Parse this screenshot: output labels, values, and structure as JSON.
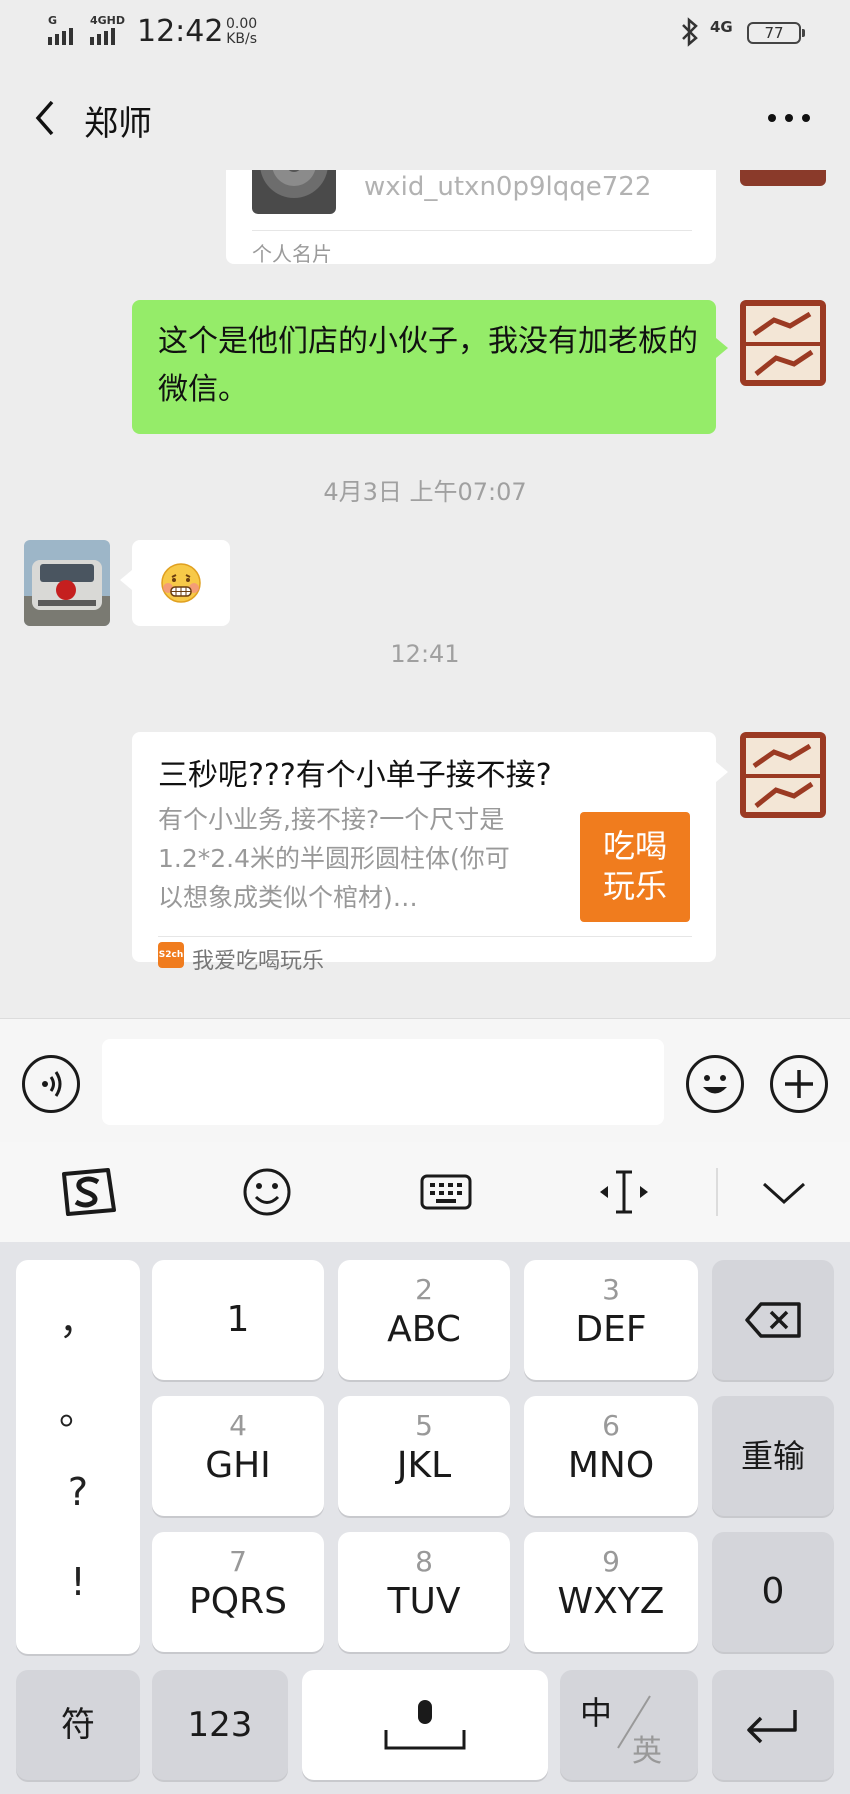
{
  "status_bar": {
    "signal1": "G",
    "signal2": "4GHD",
    "time": "12:42",
    "speed_value": "0.00",
    "speed_unit": "KB/s",
    "network": "4G",
    "battery": "77"
  },
  "header": {
    "title": "郑师",
    "back_icon": "chevron-left-icon",
    "more_icon": "more-dots-icon"
  },
  "messages": {
    "card": {
      "wxid": "wxid_utxn0p9lqqe722",
      "footer": "个人名片"
    },
    "sent_text": "这个是他们店的小伙子，我没有加老板的微信。",
    "timestamp1": "4月3日 上午07:07",
    "received_emoji": "grimacing-face-emoji",
    "timestamp2": "12:41",
    "link_card": {
      "title": "三秒呢???有个小单子接不接?",
      "description": "有个小业务,接不接?一个尺寸是1.2*2.4米的半圆形圆柱体(你可以想象成类似个棺材)…",
      "thumb_text_line1": "吃喝",
      "thumb_text_line2": "玩乐",
      "source_icon_text": "S2ch",
      "source": "我爱吃喝玩乐"
    }
  },
  "input_bar": {
    "voice_icon": "voice-icon",
    "emoji_icon": "smiley-icon",
    "plus_icon": "plus-icon"
  },
  "keyboard_toolbar": {
    "icons": [
      "sogou-logo-icon",
      "smiley-icon",
      "keyboard-icon",
      "cursor-move-icon",
      "chevron-down-icon"
    ]
  },
  "keyboard": {
    "symbols": [
      "，",
      "。",
      "?",
      "!"
    ],
    "keys": [
      {
        "num": "",
        "letters": "1"
      },
      {
        "num": "2",
        "letters": "ABC"
      },
      {
        "num": "3",
        "letters": "DEF"
      },
      {
        "num": "4",
        "letters": "GHI"
      },
      {
        "num": "5",
        "letters": "JKL"
      },
      {
        "num": "6",
        "letters": "MNO"
      },
      {
        "num": "7",
        "letters": "PQRS"
      },
      {
        "num": "8",
        "letters": "TUV"
      },
      {
        "num": "9",
        "letters": "WXYZ"
      }
    ],
    "reinput": "重输",
    "zero": "0",
    "symbol_key": "符",
    "num_key": "123",
    "lang_zh": "中",
    "lang_en": "英"
  },
  "colors": {
    "bubble_green": "#95ec69",
    "thumb_orange": "#f07c1e",
    "background": "#ededed"
  }
}
